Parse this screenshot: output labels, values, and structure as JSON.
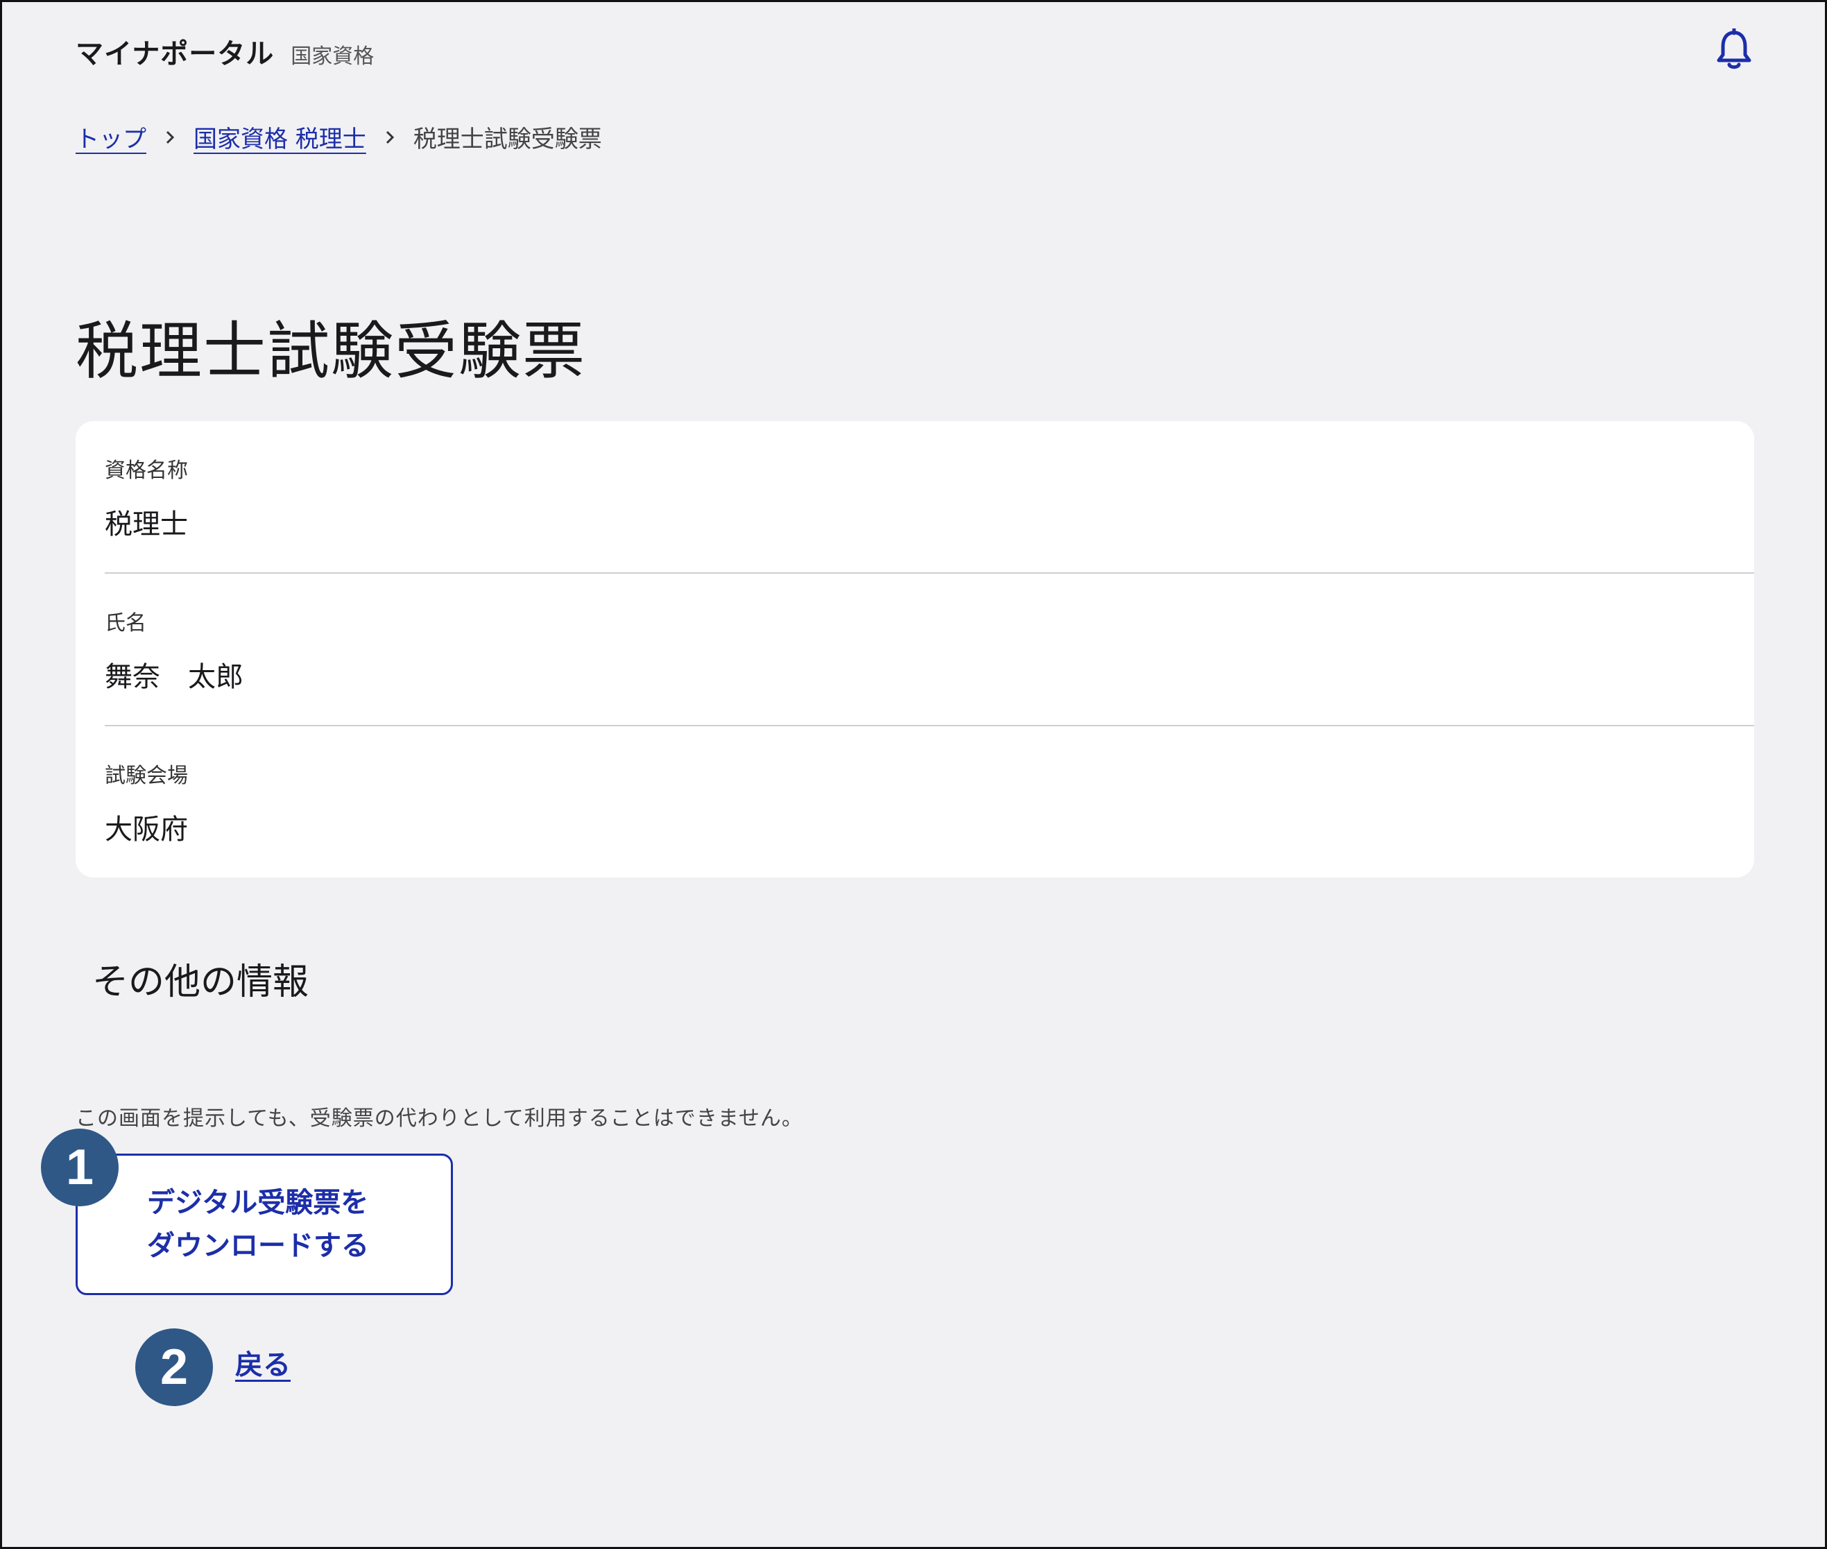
{
  "header": {
    "app_name": "マイナポータル",
    "app_section": "国家資格",
    "notification_icon": "bell-icon"
  },
  "breadcrumb": {
    "items": [
      {
        "label": "トップ",
        "link": true
      },
      {
        "label": "国家資格 税理士",
        "link": true
      },
      {
        "label": "税理士試験受験票",
        "link": false
      }
    ],
    "separator_icon": "chevron-right-icon"
  },
  "page": {
    "title": "税理士試験受験票"
  },
  "info": {
    "rows": [
      {
        "label": "資格名称",
        "value": "税理士"
      },
      {
        "label": "氏名",
        "value": "舞奈　太郎"
      },
      {
        "label": "試験会場",
        "value": "大阪府"
      }
    ]
  },
  "other": {
    "heading": "その他の情報",
    "notice": "この画面を提示しても、受験票の代わりとして利用することはできません。"
  },
  "actions": {
    "download_line1": "デジタル受験票を",
    "download_line2": "ダウンロードする",
    "back_label": "戻る"
  },
  "callouts": {
    "badge1": "1",
    "badge2": "2",
    "color": "#2f5887"
  },
  "colors": {
    "accent": "#1c2ea8",
    "background": "#f1f1f4",
    "card": "#ffffff"
  }
}
